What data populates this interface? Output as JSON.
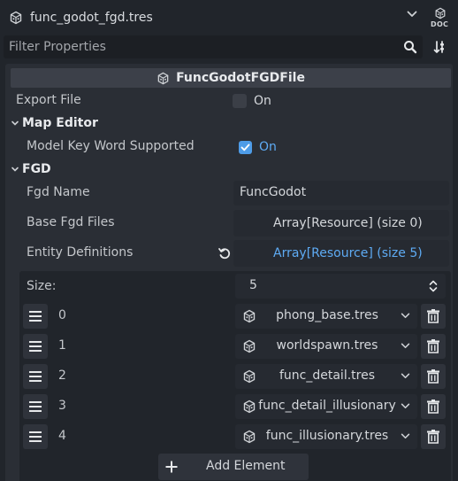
{
  "resource_bar": {
    "file_name": "func_godot_fgd.tres",
    "doc_label": "DOC"
  },
  "filter": {
    "placeholder": "Filter Properties",
    "value": ""
  },
  "class_header": {
    "title": "FuncGodotFGDFile"
  },
  "export_file": {
    "label": "Export File",
    "checked": false,
    "value_label": "On"
  },
  "section_map_editor": {
    "title": "Map Editor"
  },
  "model_key_word": {
    "label": "Model Key Word Supported",
    "checked": true,
    "value_label": "On"
  },
  "section_fgd": {
    "title": "FGD"
  },
  "fgd_name": {
    "label": "Fgd Name",
    "value": "FuncGodot"
  },
  "base_fgd_files": {
    "label": "Base Fgd Files",
    "value": "Array[Resource] (size 0)"
  },
  "entity_definitions": {
    "label": "Entity Definitions",
    "value": "Array[Resource] (size 5)"
  },
  "array": {
    "size_label": "Size:",
    "size_value": "5",
    "elements": [
      {
        "index": "0",
        "resource": "phong_base.tres"
      },
      {
        "index": "1",
        "resource": "worldspawn.tres"
      },
      {
        "index": "2",
        "resource": "func_detail.tres"
      },
      {
        "index": "3",
        "resource": "func_detail_illusionary"
      },
      {
        "index": "4",
        "resource": "func_illusionary.tres"
      }
    ],
    "add_label": "Add Element"
  },
  "colors": {
    "accent": "#5eabf4",
    "checkbox": "#4e9ce8",
    "panel": "#2a2e35",
    "background": "#21252b"
  }
}
